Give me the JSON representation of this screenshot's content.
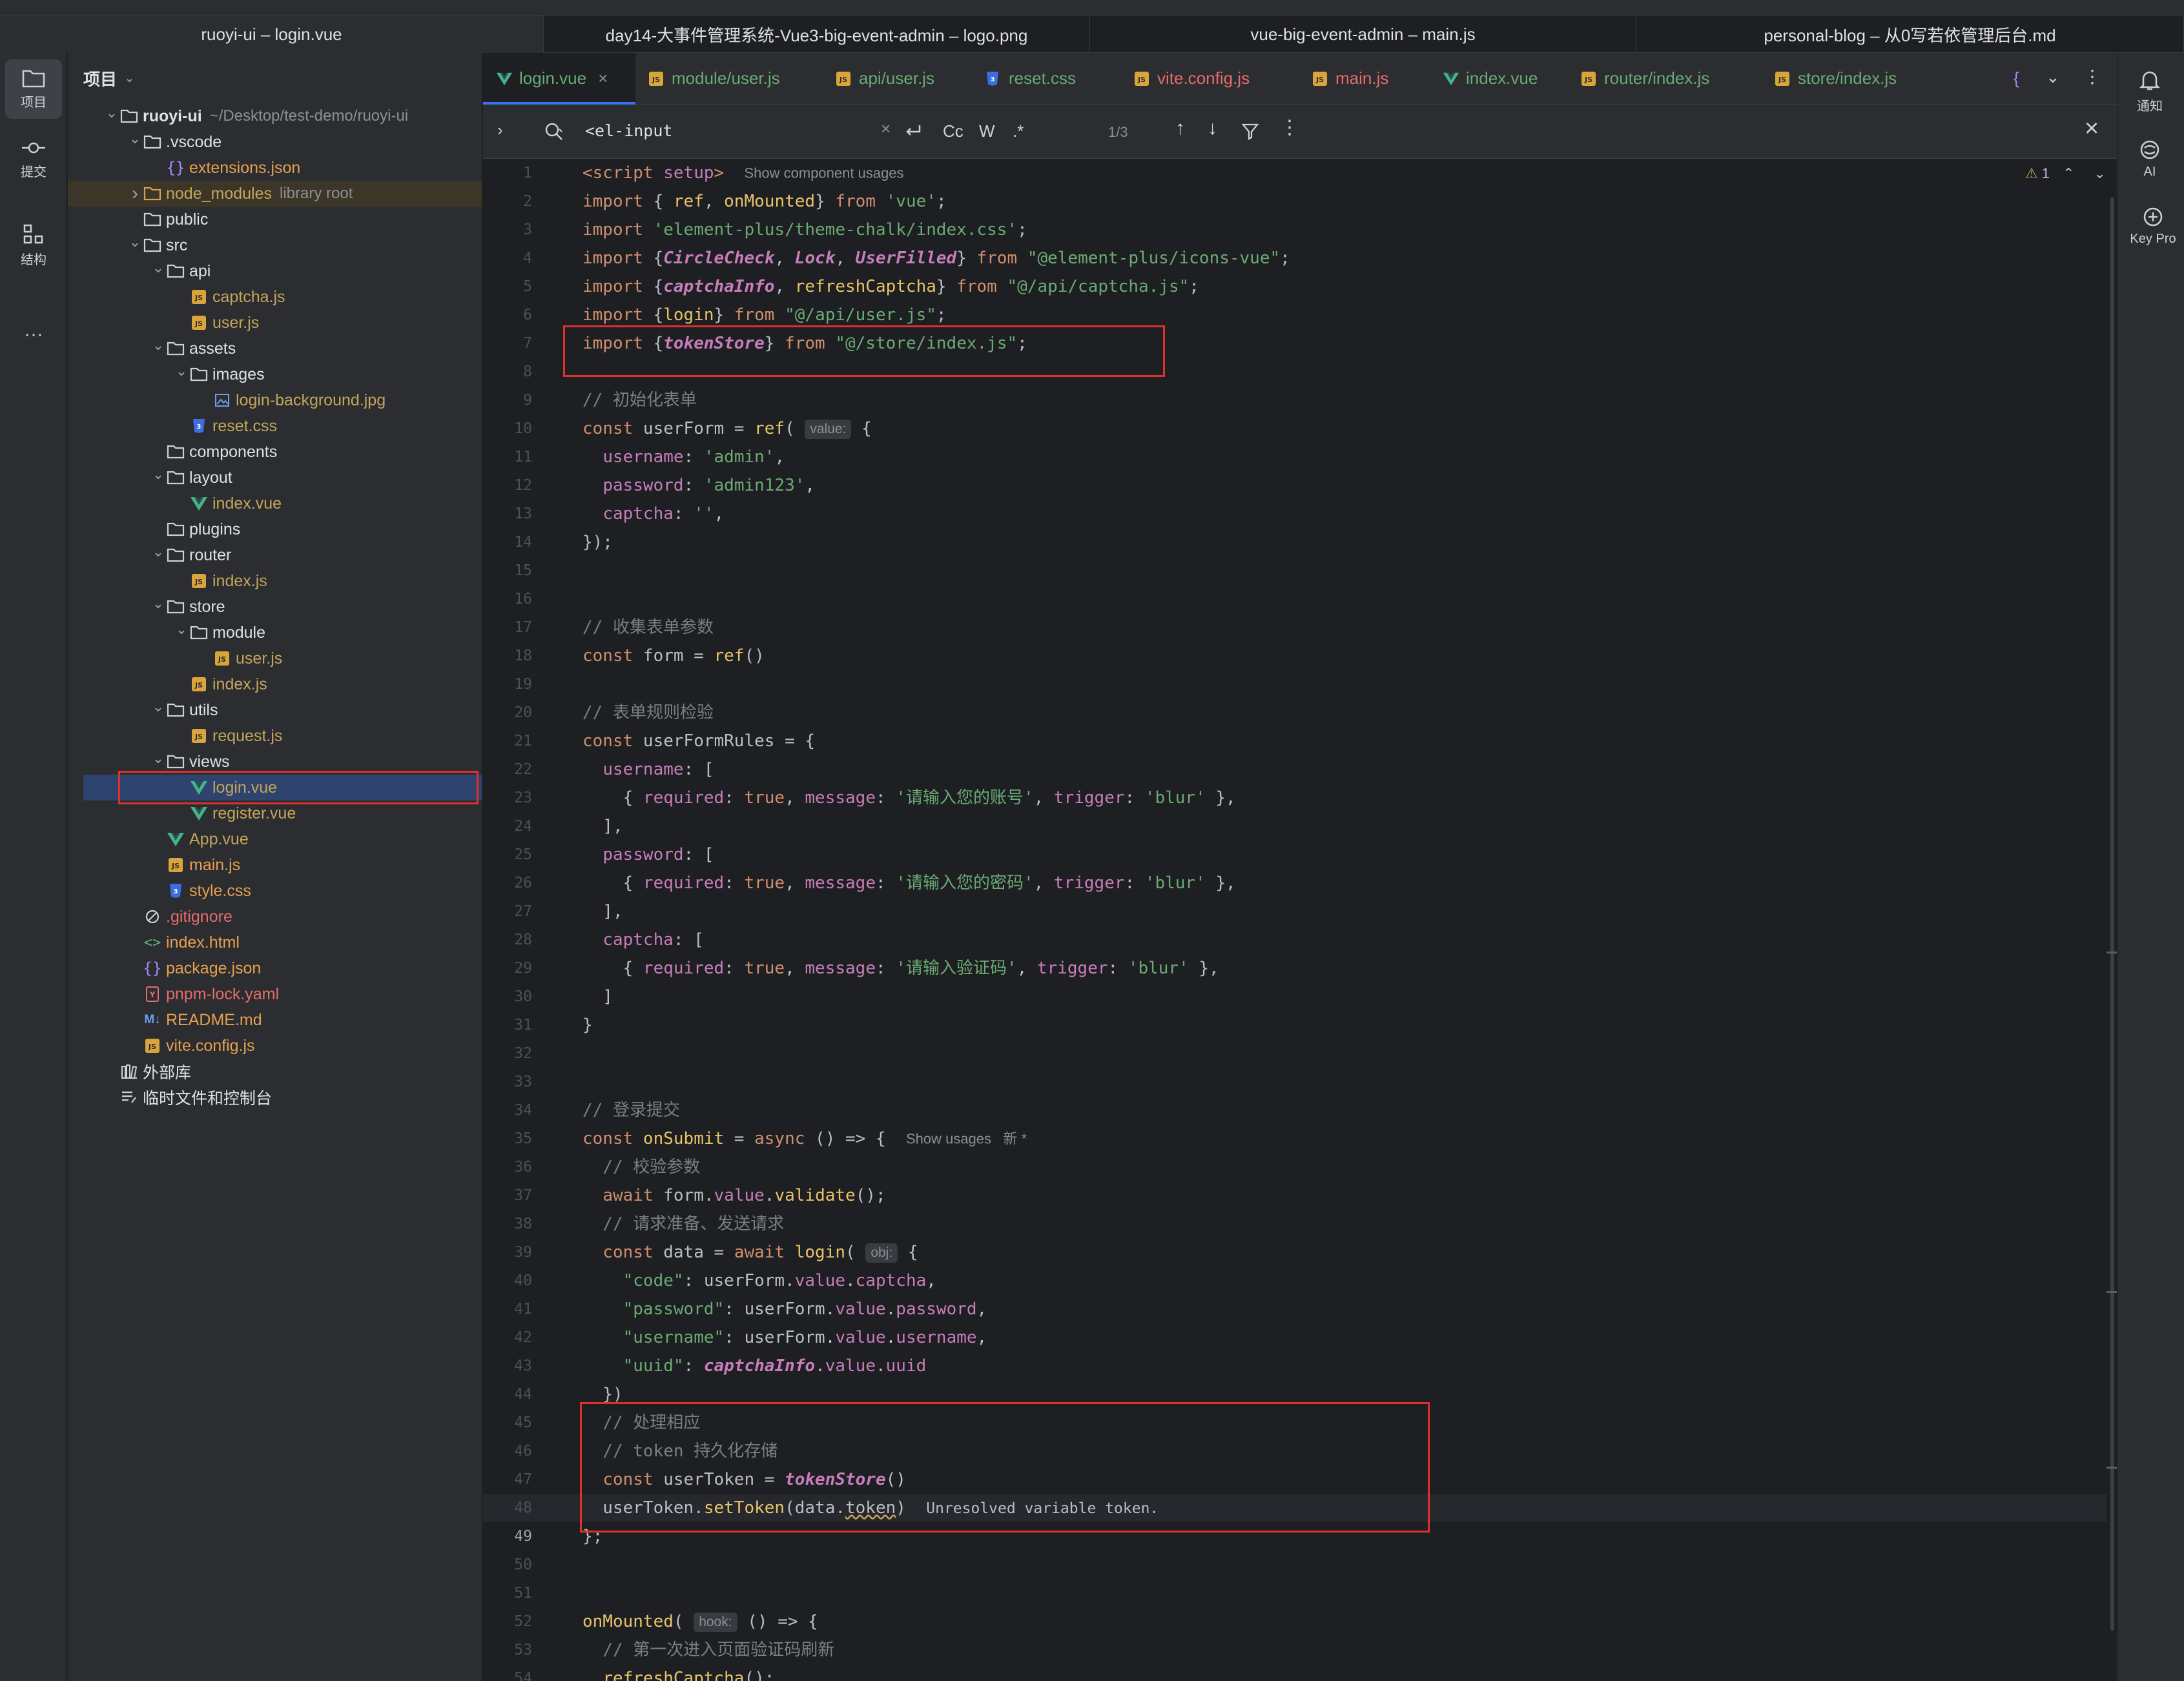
{
  "window_tabs": [
    {
      "label": "ruoyi-ui – login.vue",
      "active": true
    },
    {
      "label": "day14-大事件管理系统-Vue3-big-event-admin – logo.png",
      "active": false
    },
    {
      "label": "vue-big-event-admin – main.js",
      "active": false
    },
    {
      "label": "personal-blog – 从0写若依管理后台.md",
      "active": false
    }
  ],
  "left_strip": {
    "project": "项目",
    "commit": "提交",
    "structure": "结构",
    "more": "···"
  },
  "right_strip": {
    "notifications": "通知",
    "ai": "AI",
    "keypro": "Key Pro"
  },
  "project_panel": {
    "title": "项目",
    "tree": [
      {
        "depth": 0,
        "label": "ruoyi-ui",
        "extra": "~/Desktop/test-demo/ruoyi-ui",
        "icon": "folder",
        "chev": "v",
        "color": "def",
        "bold": true
      },
      {
        "depth": 1,
        "label": ".vscode",
        "icon": "folder",
        "chev": "v",
        "color": "def"
      },
      {
        "depth": 2,
        "label": "extensions.json",
        "icon": "json",
        "color": "orange"
      },
      {
        "depth": 1,
        "label": "node_modules",
        "extra": "library root",
        "icon": "folder-orange",
        "chev": ">",
        "color": "yellow",
        "lib": true
      },
      {
        "depth": 1,
        "label": "public",
        "icon": "folder",
        "color": "def"
      },
      {
        "depth": 1,
        "label": "src",
        "icon": "folder",
        "chev": "v",
        "color": "def"
      },
      {
        "depth": 2,
        "label": "api",
        "icon": "folder",
        "chev": "v",
        "color": "def"
      },
      {
        "depth": 3,
        "label": "captcha.js",
        "icon": "js",
        "color": "yellow"
      },
      {
        "depth": 3,
        "label": "user.js",
        "icon": "js",
        "color": "yellow"
      },
      {
        "depth": 2,
        "label": "assets",
        "icon": "folder",
        "chev": "v",
        "color": "def"
      },
      {
        "depth": 3,
        "label": "images",
        "icon": "folder",
        "chev": "v",
        "color": "def"
      },
      {
        "depth": 4,
        "label": "login-background.jpg",
        "icon": "image",
        "color": "yellow"
      },
      {
        "depth": 3,
        "label": "reset.css",
        "icon": "css",
        "color": "yellow"
      },
      {
        "depth": 2,
        "label": "components",
        "icon": "folder",
        "color": "def"
      },
      {
        "depth": 2,
        "label": "layout",
        "icon": "folder",
        "chev": "v",
        "color": "def"
      },
      {
        "depth": 3,
        "label": "index.vue",
        "icon": "vue",
        "color": "yellow"
      },
      {
        "depth": 2,
        "label": "plugins",
        "icon": "folder",
        "color": "def"
      },
      {
        "depth": 2,
        "label": "router",
        "icon": "folder",
        "chev": "v",
        "color": "def"
      },
      {
        "depth": 3,
        "label": "index.js",
        "icon": "js",
        "color": "yellow"
      },
      {
        "depth": 2,
        "label": "store",
        "icon": "folder",
        "chev": "v",
        "color": "def"
      },
      {
        "depth": 3,
        "label": "module",
        "icon": "folder",
        "chev": "v",
        "color": "def"
      },
      {
        "depth": 4,
        "label": "user.js",
        "icon": "js",
        "color": "yellow"
      },
      {
        "depth": 3,
        "label": "index.js",
        "icon": "js",
        "color": "yellow"
      },
      {
        "depth": 2,
        "label": "utils",
        "icon": "folder",
        "chev": "v",
        "color": "def"
      },
      {
        "depth": 3,
        "label": "request.js",
        "icon": "js",
        "color": "yellow"
      },
      {
        "depth": 2,
        "label": "views",
        "icon": "folder",
        "chev": "v",
        "color": "def"
      },
      {
        "depth": 3,
        "label": "login.vue",
        "icon": "vue",
        "color": "yellow",
        "selected": true
      },
      {
        "depth": 3,
        "label": "register.vue",
        "icon": "vue",
        "color": "yellow"
      },
      {
        "depth": 2,
        "label": "App.vue",
        "icon": "vue",
        "color": "yellow"
      },
      {
        "depth": 2,
        "label": "main.js",
        "icon": "js",
        "color": "orange"
      },
      {
        "depth": 2,
        "label": "style.css",
        "icon": "css",
        "color": "orange"
      },
      {
        "depth": 1,
        "label": ".gitignore",
        "icon": "ignore",
        "color": "red"
      },
      {
        "depth": 1,
        "label": "index.html",
        "icon": "html",
        "color": "orange"
      },
      {
        "depth": 1,
        "label": "package.json",
        "icon": "json",
        "color": "orange"
      },
      {
        "depth": 1,
        "label": "pnpm-lock.yaml",
        "icon": "yaml",
        "color": "red"
      },
      {
        "depth": 1,
        "label": "README.md",
        "icon": "md",
        "color": "orange"
      },
      {
        "depth": 1,
        "label": "vite.config.js",
        "icon": "js",
        "color": "orange"
      },
      {
        "depth": 0,
        "label": "外部库",
        "icon": "lib",
        "color": "def"
      },
      {
        "depth": 0,
        "label": "临时文件和控制台",
        "icon": "scratch",
        "color": "def"
      }
    ]
  },
  "editor_tabs": [
    {
      "label": "login.vue",
      "icon": "vue",
      "color": "#6aab73",
      "active": true,
      "closable": true
    },
    {
      "label": "module/user.js",
      "icon": "js",
      "color": "#6aab73"
    },
    {
      "label": "api/user.js",
      "icon": "js",
      "color": "#6aab73"
    },
    {
      "label": "reset.css",
      "icon": "css",
      "color": "#6aab73"
    },
    {
      "label": "vite.config.js",
      "icon": "js",
      "color": "#e86b6b"
    },
    {
      "label": "main.js",
      "icon": "js",
      "color": "#e86b6b"
    },
    {
      "label": "index.vue",
      "icon": "vue",
      "color": "#6aab73"
    },
    {
      "label": "router/index.js",
      "icon": "js",
      "color": "#6aab73"
    },
    {
      "label": "store/index.js",
      "icon": "js",
      "color": "#6aab73"
    }
  ],
  "find_bar": {
    "query": "<el-input",
    "match_case": "Cc",
    "words": "W",
    "regex": ".*",
    "count": "1/3"
  },
  "editor": {
    "warning_count": "1",
    "current_line": 49,
    "lines": [
      [
        [
          "kw",
          "<script "
        ],
        [
          "prop",
          "setup"
        ],
        [
          "kw",
          ">"
        ],
        [
          "sp",
          "  "
        ],
        [
          "hint",
          "Show component usages"
        ]
      ],
      [
        [
          "kw",
          "import "
        ],
        [
          "d",
          "{ "
        ],
        [
          "fn2",
          "ref"
        ],
        [
          "d",
          ", "
        ],
        [
          "fn2",
          "onMounted"
        ],
        [
          "d",
          "} "
        ],
        [
          "kw",
          "from "
        ],
        [
          "str",
          "'vue'"
        ],
        [
          "d",
          ";"
        ]
      ],
      [
        [
          "kw",
          "import "
        ],
        [
          "str",
          "'element-plus/theme-chalk/index.css'"
        ],
        [
          "d",
          ";"
        ]
      ],
      [
        [
          "kw",
          "import "
        ],
        [
          "d",
          "{"
        ],
        [
          "it",
          "CircleCheck"
        ],
        [
          "d",
          ", "
        ],
        [
          "it",
          "Lock"
        ],
        [
          "d",
          ", "
        ],
        [
          "it",
          "UserFilled"
        ],
        [
          "d",
          "} "
        ],
        [
          "kw",
          "from "
        ],
        [
          "str",
          "\"@element-plus/icons-vue\""
        ],
        [
          "d",
          ";"
        ]
      ],
      [
        [
          "kw",
          "import "
        ],
        [
          "d",
          "{"
        ],
        [
          "it",
          "captchaInfo"
        ],
        [
          "d",
          ", "
        ],
        [
          "fn2",
          "refreshCaptcha"
        ],
        [
          "d",
          "} "
        ],
        [
          "kw",
          "from "
        ],
        [
          "str",
          "\"@/api/captcha.js\""
        ],
        [
          "d",
          ";"
        ]
      ],
      [
        [
          "kw",
          "import "
        ],
        [
          "d",
          "{"
        ],
        [
          "fn2",
          "login"
        ],
        [
          "d",
          "} "
        ],
        [
          "kw",
          "from "
        ],
        [
          "str",
          "\"@/api/user.js\""
        ],
        [
          "d",
          ";"
        ]
      ],
      [
        [
          "kw",
          "import "
        ],
        [
          "d",
          "{"
        ],
        [
          "it",
          "tokenStore"
        ],
        [
          "d",
          "} "
        ],
        [
          "kw",
          "from "
        ],
        [
          "str",
          "\"@/store/index.js\""
        ],
        [
          "d",
          ";"
        ]
      ],
      [],
      [
        [
          "cm",
          "// 初始化表单"
        ]
      ],
      [
        [
          "kw",
          "const "
        ],
        [
          "d",
          "userForm = "
        ],
        [
          "fn2",
          "ref"
        ],
        [
          "d",
          "( "
        ],
        [
          "inl",
          "value:"
        ],
        [
          "d",
          " {"
        ]
      ],
      [
        [
          "d",
          "  "
        ],
        [
          "prop",
          "username"
        ],
        [
          "d",
          ": "
        ],
        [
          "str",
          "'admin'"
        ],
        [
          "d",
          ","
        ]
      ],
      [
        [
          "d",
          "  "
        ],
        [
          "prop",
          "password"
        ],
        [
          "d",
          ": "
        ],
        [
          "str",
          "'admin123'"
        ],
        [
          "d",
          ","
        ]
      ],
      [
        [
          "d",
          "  "
        ],
        [
          "prop",
          "captcha"
        ],
        [
          "d",
          ": "
        ],
        [
          "str",
          "''"
        ],
        [
          "d",
          ","
        ]
      ],
      [
        [
          "d",
          "});"
        ]
      ],
      [],
      [],
      [
        [
          "cm",
          "// 收集表单参数"
        ]
      ],
      [
        [
          "kw",
          "const "
        ],
        [
          "d",
          "form = "
        ],
        [
          "fn2",
          "ref"
        ],
        [
          "d",
          "()"
        ]
      ],
      [],
      [
        [
          "cm",
          "// 表单规则检验"
        ]
      ],
      [
        [
          "kw",
          "const "
        ],
        [
          "d",
          "userFormRules = {"
        ]
      ],
      [
        [
          "d",
          "  "
        ],
        [
          "prop",
          "username"
        ],
        [
          "d",
          ": ["
        ]
      ],
      [
        [
          "d",
          "    { "
        ],
        [
          "prop",
          "required"
        ],
        [
          "d",
          ": "
        ],
        [
          "kw",
          "true"
        ],
        [
          "d",
          ", "
        ],
        [
          "prop",
          "message"
        ],
        [
          "d",
          ": "
        ],
        [
          "str",
          "'请输入您的账号'"
        ],
        [
          "d",
          ", "
        ],
        [
          "prop",
          "trigger"
        ],
        [
          "d",
          ": "
        ],
        [
          "str",
          "'blur'"
        ],
        [
          "d",
          " },"
        ]
      ],
      [
        [
          "d",
          "  ],"
        ]
      ],
      [
        [
          "d",
          "  "
        ],
        [
          "prop",
          "password"
        ],
        [
          "d",
          ": ["
        ]
      ],
      [
        [
          "d",
          "    { "
        ],
        [
          "prop",
          "required"
        ],
        [
          "d",
          ": "
        ],
        [
          "kw",
          "true"
        ],
        [
          "d",
          ", "
        ],
        [
          "prop",
          "message"
        ],
        [
          "d",
          ": "
        ],
        [
          "str",
          "'请输入您的密码'"
        ],
        [
          "d",
          ", "
        ],
        [
          "prop",
          "trigger"
        ],
        [
          "d",
          ": "
        ],
        [
          "str",
          "'blur'"
        ],
        [
          "d",
          " },"
        ]
      ],
      [
        [
          "d",
          "  ],"
        ]
      ],
      [
        [
          "d",
          "  "
        ],
        [
          "prop",
          "captcha"
        ],
        [
          "d",
          ": ["
        ]
      ],
      [
        [
          "d",
          "    { "
        ],
        [
          "prop",
          "required"
        ],
        [
          "d",
          ": "
        ],
        [
          "kw",
          "true"
        ],
        [
          "d",
          ", "
        ],
        [
          "prop",
          "message"
        ],
        [
          "d",
          ": "
        ],
        [
          "str",
          "'请输入验证码'"
        ],
        [
          "d",
          ", "
        ],
        [
          "prop",
          "trigger"
        ],
        [
          "d",
          ": "
        ],
        [
          "str",
          "'blur'"
        ],
        [
          "d",
          " },"
        ]
      ],
      [
        [
          "d",
          "  ]"
        ]
      ],
      [
        [
          "d",
          "}"
        ]
      ],
      [],
      [],
      [
        [
          "cm",
          "// 登录提交"
        ]
      ],
      [
        [
          "kw",
          "const "
        ],
        [
          "fn2",
          "onSubmit"
        ],
        [
          "d",
          " = "
        ],
        [
          "kw",
          "async "
        ],
        [
          "d",
          "() => {  "
        ],
        [
          "hint",
          "Show usages   新 *"
        ]
      ],
      [
        [
          "d",
          "  "
        ],
        [
          "cm",
          "// 校验参数"
        ]
      ],
      [
        [
          "d",
          "  "
        ],
        [
          "kw",
          "await "
        ],
        [
          "d",
          "form."
        ],
        [
          "prop",
          "value"
        ],
        [
          "d",
          "."
        ],
        [
          "fn2",
          "validate"
        ],
        [
          "d",
          "();"
        ]
      ],
      [
        [
          "d",
          "  "
        ],
        [
          "cm",
          "// 请求准备、发送请求"
        ]
      ],
      [
        [
          "d",
          "  "
        ],
        [
          "kw",
          "const "
        ],
        [
          "d",
          "data = "
        ],
        [
          "kw",
          "await "
        ],
        [
          "fn2",
          "login"
        ],
        [
          "d",
          "( "
        ],
        [
          "inl",
          "obj:"
        ],
        [
          "d",
          " {"
        ]
      ],
      [
        [
          "d",
          "    "
        ],
        [
          "str",
          "\"code\""
        ],
        [
          "d",
          ": userForm."
        ],
        [
          "prop",
          "value"
        ],
        [
          "d",
          "."
        ],
        [
          "prop",
          "captcha"
        ],
        [
          "d",
          ","
        ]
      ],
      [
        [
          "d",
          "    "
        ],
        [
          "str",
          "\"password\""
        ],
        [
          "d",
          ": userForm."
        ],
        [
          "prop",
          "value"
        ],
        [
          "d",
          "."
        ],
        [
          "prop",
          "password"
        ],
        [
          "d",
          ","
        ]
      ],
      [
        [
          "d",
          "    "
        ],
        [
          "str",
          "\"username\""
        ],
        [
          "d",
          ": userForm."
        ],
        [
          "prop",
          "value"
        ],
        [
          "d",
          "."
        ],
        [
          "prop",
          "username"
        ],
        [
          "d",
          ","
        ]
      ],
      [
        [
          "d",
          "    "
        ],
        [
          "str",
          "\"uuid\""
        ],
        [
          "d",
          ": "
        ],
        [
          "it",
          "captchaInfo"
        ],
        [
          "d",
          "."
        ],
        [
          "prop",
          "value"
        ],
        [
          "d",
          "."
        ],
        [
          "prop",
          "uuid"
        ]
      ],
      [
        [
          "d",
          "  })"
        ]
      ],
      [
        [
          "d",
          "  "
        ],
        [
          "cm",
          "// 处理相应"
        ]
      ],
      [
        [
          "d",
          "  "
        ],
        [
          "cm",
          "// token 持久化存储"
        ]
      ],
      [
        [
          "d",
          "  "
        ],
        [
          "kw",
          "const "
        ],
        [
          "d",
          "userToken = "
        ],
        [
          "it",
          "tokenStore"
        ],
        [
          "d",
          "()"
        ]
      ],
      [
        [
          "d",
          "  userToken."
        ],
        [
          "fn2",
          "setToken"
        ],
        [
          "d",
          "(data."
        ],
        [
          "wavy",
          "token"
        ],
        [
          "d",
          ")  "
        ],
        [
          "errmsg",
          "Unresolved variable token."
        ]
      ],
      [
        [
          "d",
          "};"
        ]
      ],
      [],
      [],
      [
        [
          "fn2",
          "onMounted"
        ],
        [
          "d",
          "( "
        ],
        [
          "inl",
          "hook:"
        ],
        [
          "d",
          " () => {"
        ]
      ],
      [
        [
          "d",
          "  "
        ],
        [
          "cm",
          "// 第一次进入页面验证码刷新"
        ]
      ],
      [
        [
          "d",
          "  "
        ],
        [
          "fn2",
          "refreshCaptcha"
        ],
        [
          "d",
          "();"
        ]
      ]
    ]
  }
}
